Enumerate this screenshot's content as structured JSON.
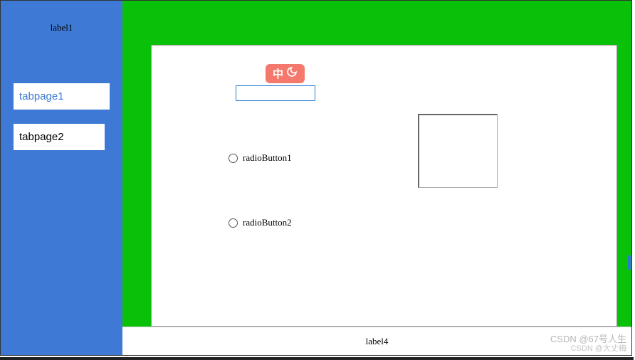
{
  "sidebar": {
    "label": "label1",
    "tabs": [
      {
        "label": "tabpage1"
      },
      {
        "label": "tabpage2"
      }
    ]
  },
  "ime": {
    "text": "中"
  },
  "input": {
    "value": ""
  },
  "radios": [
    {
      "label": "radioButton1"
    },
    {
      "label": "radioButton2"
    }
  ],
  "footer": {
    "label": "label4"
  },
  "watermark": {
    "line1": "CSDN @67号人生",
    "line2": "CSDN @大丈梅"
  }
}
